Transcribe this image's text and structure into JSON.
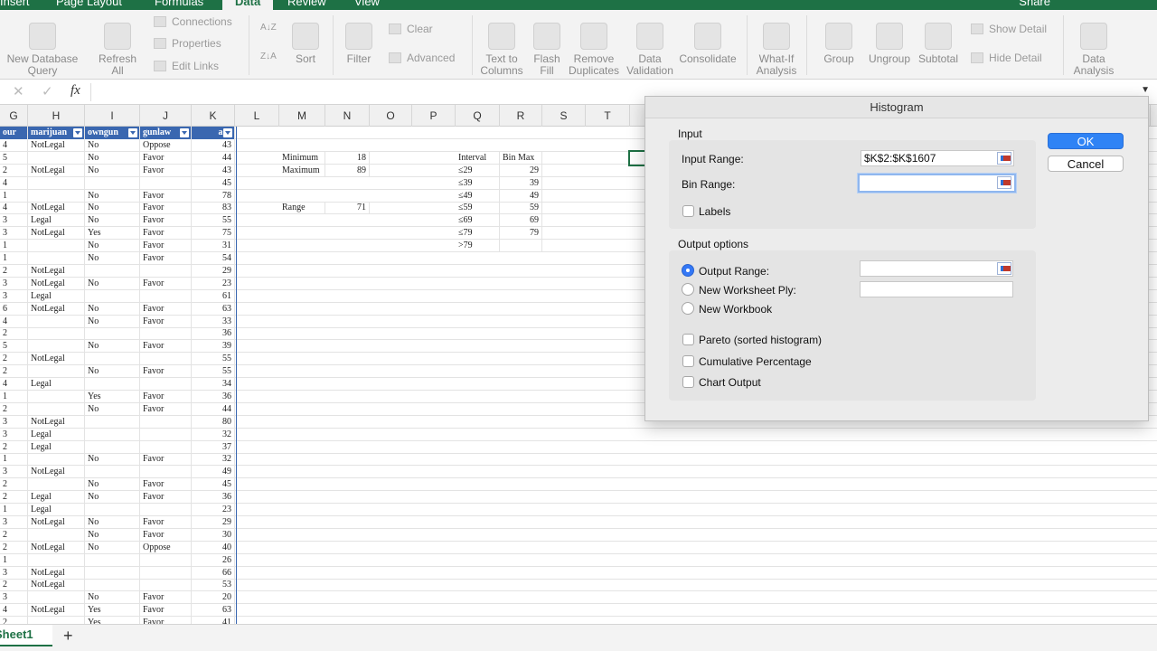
{
  "ribbon_tabs": [
    {
      "label": "Insert",
      "active": false
    },
    {
      "label": "Page Layout",
      "active": false
    },
    {
      "label": "Formulas",
      "active": false
    },
    {
      "label": "Data",
      "active": true
    },
    {
      "label": "Review",
      "active": false
    },
    {
      "label": "View",
      "active": false
    }
  ],
  "share_label": "Share",
  "ribbon": {
    "new_db_query": "New Database\nQuery",
    "refresh_all": "Refresh\nAll",
    "connections": "Connections",
    "properties": "Properties",
    "edit_links": "Edit Links",
    "sort": "Sort",
    "filter": "Filter",
    "clear": "Clear",
    "advanced": "Advanced",
    "text_to_columns": "Text to\nColumns",
    "flash_fill": "Flash\nFill",
    "remove_duplicates": "Remove\nDuplicates",
    "data_validation": "Data\nValidation",
    "consolidate": "Consolidate",
    "what_if": "What-If\nAnalysis",
    "group": "Group",
    "ungroup": "Ungroup",
    "subtotal": "Subtotal",
    "show_detail": "Show Detail",
    "hide_detail": "Hide Detail",
    "data_analysis": "Data\nAnalysis"
  },
  "formula_bar": {
    "fx": "fx",
    "value": ""
  },
  "columns": [
    "G",
    "H",
    "I",
    "J",
    "K",
    "L",
    "M",
    "N",
    "O",
    "P",
    "Q",
    "R",
    "S",
    "T"
  ],
  "table_headers": [
    "our",
    "marijuan",
    "owngun",
    "gunlaw",
    "age"
  ],
  "rows": [
    {
      "g": "4",
      "h": "NotLegal",
      "i": "No",
      "j": "Oppose",
      "k": "43"
    },
    {
      "g": "5",
      "h": "",
      "i": "No",
      "j": "Favor",
      "k": "44"
    },
    {
      "g": "2",
      "h": "NotLegal",
      "i": "No",
      "j": "Favor",
      "k": "43"
    },
    {
      "g": "4",
      "h": "",
      "i": "",
      "j": "",
      "k": "45"
    },
    {
      "g": "1",
      "h": "",
      "i": "No",
      "j": "Favor",
      "k": "78"
    },
    {
      "g": "4",
      "h": "NotLegal",
      "i": "No",
      "j": "Favor",
      "k": "83"
    },
    {
      "g": "3",
      "h": "Legal",
      "i": "No",
      "j": "Favor",
      "k": "55"
    },
    {
      "g": "3",
      "h": "NotLegal",
      "i": "Yes",
      "j": "Favor",
      "k": "75"
    },
    {
      "g": "1",
      "h": "",
      "i": "No",
      "j": "Favor",
      "k": "31"
    },
    {
      "g": "1",
      "h": "",
      "i": "No",
      "j": "Favor",
      "k": "54"
    },
    {
      "g": "2",
      "h": "NotLegal",
      "i": "",
      "j": "",
      "k": "29"
    },
    {
      "g": "3",
      "h": "NotLegal",
      "i": "No",
      "j": "Favor",
      "k": "23"
    },
    {
      "g": "3",
      "h": "Legal",
      "i": "",
      "j": "",
      "k": "61"
    },
    {
      "g": "6",
      "h": "NotLegal",
      "i": "No",
      "j": "Favor",
      "k": "63"
    },
    {
      "g": "4",
      "h": "",
      "i": "No",
      "j": "Favor",
      "k": "33"
    },
    {
      "g": "2",
      "h": "",
      "i": "",
      "j": "",
      "k": "36"
    },
    {
      "g": "5",
      "h": "",
      "i": "No",
      "j": "Favor",
      "k": "39"
    },
    {
      "g": "2",
      "h": "NotLegal",
      "i": "",
      "j": "",
      "k": "55"
    },
    {
      "g": "2",
      "h": "",
      "i": "No",
      "j": "Favor",
      "k": "55"
    },
    {
      "g": "4",
      "h": "Legal",
      "i": "",
      "j": "",
      "k": "34"
    },
    {
      "g": "1",
      "h": "",
      "i": "Yes",
      "j": "Favor",
      "k": "36"
    },
    {
      "g": "2",
      "h": "",
      "i": "No",
      "j": "Favor",
      "k": "44"
    },
    {
      "g": "3",
      "h": "NotLegal",
      "i": "",
      "j": "",
      "k": "80"
    },
    {
      "g": "3",
      "h": "Legal",
      "i": "",
      "j": "",
      "k": "32"
    },
    {
      "g": "2",
      "h": "Legal",
      "i": "",
      "j": "",
      "k": "37"
    },
    {
      "g": "1",
      "h": "",
      "i": "No",
      "j": "Favor",
      "k": "32"
    },
    {
      "g": "3",
      "h": "NotLegal",
      "i": "",
      "j": "",
      "k": "49"
    },
    {
      "g": "2",
      "h": "",
      "i": "No",
      "j": "Favor",
      "k": "45"
    },
    {
      "g": "2",
      "h": "Legal",
      "i": "No",
      "j": "Favor",
      "k": "36"
    },
    {
      "g": "1",
      "h": "Legal",
      "i": "",
      "j": "",
      "k": "23"
    },
    {
      "g": "3",
      "h": "NotLegal",
      "i": "No",
      "j": "Favor",
      "k": "29"
    },
    {
      "g": "2",
      "h": "",
      "i": "No",
      "j": "Favor",
      "k": "30"
    },
    {
      "g": "2",
      "h": "NotLegal",
      "i": "No",
      "j": "Oppose",
      "k": "40"
    },
    {
      "g": "1",
      "h": "",
      "i": "",
      "j": "",
      "k": "26"
    },
    {
      "g": "3",
      "h": "NotLegal",
      "i": "",
      "j": "",
      "k": "66"
    },
    {
      "g": "2",
      "h": "NotLegal",
      "i": "",
      "j": "",
      "k": "53"
    },
    {
      "g": "3",
      "h": "",
      "i": "No",
      "j": "Favor",
      "k": "20"
    },
    {
      "g": "4",
      "h": "NotLegal",
      "i": "Yes",
      "j": "Favor",
      "k": "63"
    },
    {
      "g": "2",
      "h": "",
      "i": "Yes",
      "j": "Favor",
      "k": "41"
    }
  ],
  "stats": [
    {
      "label": "Minimum",
      "value": "18",
      "row": 2
    },
    {
      "label": "Maximum",
      "value": "89",
      "row": 3
    },
    {
      "label": "Range",
      "value": "71",
      "row": 6
    }
  ],
  "bins": {
    "interval_header": "Interval",
    "max_header": "Bin Max",
    "items": [
      {
        "interval": "≤29",
        "max": "29"
      },
      {
        "interval": "≤39",
        "max": "39"
      },
      {
        "interval": "≤49",
        "max": "49"
      },
      {
        "interval": "≤59",
        "max": "59"
      },
      {
        "interval": "≤69",
        "max": "69"
      },
      {
        "interval": "≤79",
        "max": "79"
      },
      {
        "interval": ">79",
        "max": ""
      }
    ]
  },
  "sheet_tab": "Sheet1",
  "add_sheet": "+",
  "dialog": {
    "title": "Histogram",
    "input_group": "Input",
    "input_range_label": "Input Range:",
    "input_range_value": "$K$2:$K$1607",
    "bin_range_label": "Bin Range:",
    "bin_range_value": "",
    "labels_label": "Labels",
    "output_group": "Output options",
    "output_range_label": "Output Range:",
    "new_ply_label": "New Worksheet Ply:",
    "new_workbook_label": "New Workbook",
    "pareto_label": "Pareto (sorted histogram)",
    "cumulative_label": "Cumulative Percentage",
    "chart_label": "Chart Output",
    "ok": "OK",
    "cancel": "Cancel"
  }
}
